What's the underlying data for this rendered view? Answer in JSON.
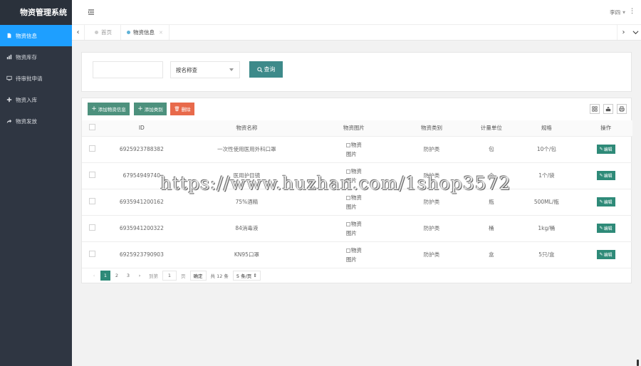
{
  "app": {
    "title": "物资管理系统"
  },
  "sidebar": {
    "items": [
      {
        "label": "物资信息",
        "icon": "document-icon",
        "active": true
      },
      {
        "label": "物资库存",
        "icon": "bar-chart-icon",
        "active": false
      },
      {
        "label": "待审批申请",
        "icon": "monitor-icon",
        "active": false
      },
      {
        "label": "物资入库",
        "icon": "plus-icon",
        "active": false
      },
      {
        "label": "物资发放",
        "icon": "share-icon",
        "active": false
      }
    ]
  },
  "header": {
    "user": "李四"
  },
  "tabs": [
    {
      "label": "首页",
      "active": false
    },
    {
      "label": "物资信息",
      "active": true
    }
  ],
  "search": {
    "input_value": "",
    "select_value": "按名称查",
    "query_label": "查询"
  },
  "toolbar": {
    "add_info_label": "添加物资信息",
    "add_category_label": "添加类别",
    "delete_label": "删除"
  },
  "table": {
    "headers": [
      "ID",
      "物资名称",
      "物资图片",
      "物资类别",
      "计量单位",
      "规格",
      "操作"
    ],
    "rows": [
      {
        "id": "6925923788382",
        "name": "一次性使用医用外科口罩",
        "image_alt_1": "物资",
        "image_alt_2": "图片",
        "category": "防护类",
        "unit": "包",
        "spec": "10个/包",
        "action": "编辑"
      },
      {
        "id": "67954949740",
        "name": "医用护目镜",
        "image_alt_1": "物资",
        "image_alt_2": "图片",
        "category": "防护类",
        "unit": "个",
        "spec": "1个/袋",
        "action": "编辑"
      },
      {
        "id": "6935941200162",
        "name": "75%酒精",
        "image_alt_1": "物资",
        "image_alt_2": "图片",
        "category": "防护类",
        "unit": "瓶",
        "spec": "500ML/瓶",
        "action": "编辑"
      },
      {
        "id": "6935941200322",
        "name": "84消毒液",
        "image_alt_1": "物资",
        "image_alt_2": "图片",
        "category": "防护类",
        "unit": "桶",
        "spec": "1kg/桶",
        "action": "编辑"
      },
      {
        "id": "6925923790903",
        "name": "KN95口罩",
        "image_alt_1": "物资",
        "image_alt_2": "图片",
        "category": "防护类",
        "unit": "盒",
        "spec": "5只/盒",
        "action": "编辑"
      }
    ]
  },
  "pagination": {
    "pages": [
      "1",
      "2",
      "3"
    ],
    "current": "1",
    "goto_label": "到第",
    "goto_value": "1",
    "page_suffix": "页",
    "confirm_label": "确定",
    "total_label": "共 12 条",
    "limit_label": "5 条/页"
  },
  "watermark": "https://www.huzhan.com/1shop3572",
  "colors": {
    "sidebar": "#2f3642",
    "active": "#1e9fff",
    "primary": "#3d8a8a",
    "danger": "#e86a4b"
  }
}
